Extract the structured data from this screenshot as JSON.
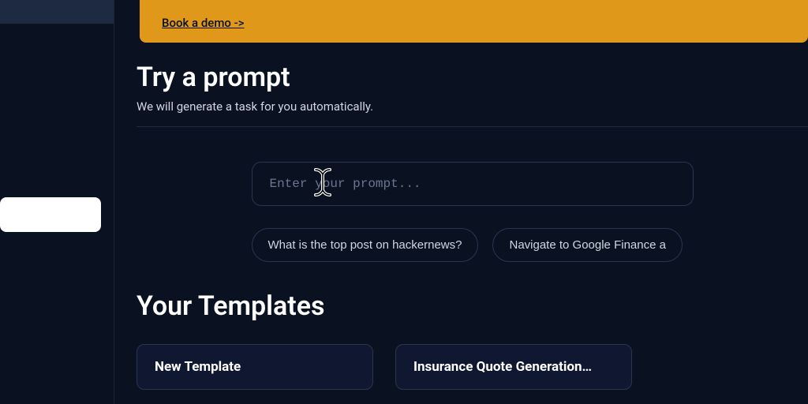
{
  "banner": {
    "link_label": "Book a demo ->"
  },
  "prompt": {
    "title": "Try a prompt",
    "subtitle": "We will generate a task for you automatically.",
    "placeholder": "Enter your prompt...",
    "suggestions": [
      "What is the top post on hackernews?",
      "Navigate to Google Finance a"
    ]
  },
  "templates": {
    "title": "Your Templates",
    "cards": [
      {
        "label": "New Template"
      },
      {
        "label": "Insurance Quote Generation…"
      }
    ]
  }
}
